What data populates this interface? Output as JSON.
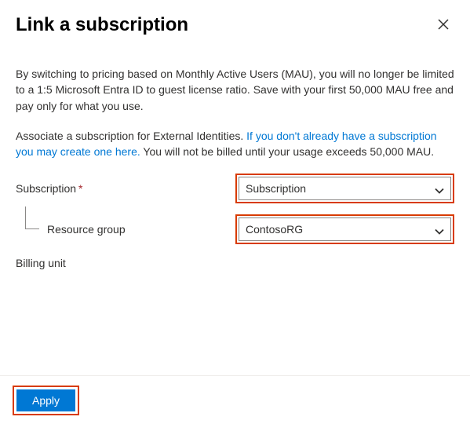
{
  "panel": {
    "title": "Link a subscription",
    "intro": "By switching to pricing based on Monthly Active Users (MAU), you will no longer be limited to a 1:5 Microsoft Entra ID to guest license ratio. Save with your first 50,000 MAU free and pay only for what you use.",
    "associate_prefix": "Associate a subscription for External Identities. ",
    "associate_link": "If you don't already have a subscription you may create one here.",
    "associate_suffix": " You will not be billed until your usage exceeds 50,000 MAU."
  },
  "fields": {
    "subscription": {
      "label": "Subscription",
      "value": "Subscription",
      "required": true
    },
    "resource_group": {
      "label": "Resource group",
      "value": "ContosoRG",
      "required": false
    },
    "billing_unit": {
      "label": "Billing unit"
    }
  },
  "actions": {
    "apply": "Apply"
  },
  "marks": {
    "required": "*"
  }
}
